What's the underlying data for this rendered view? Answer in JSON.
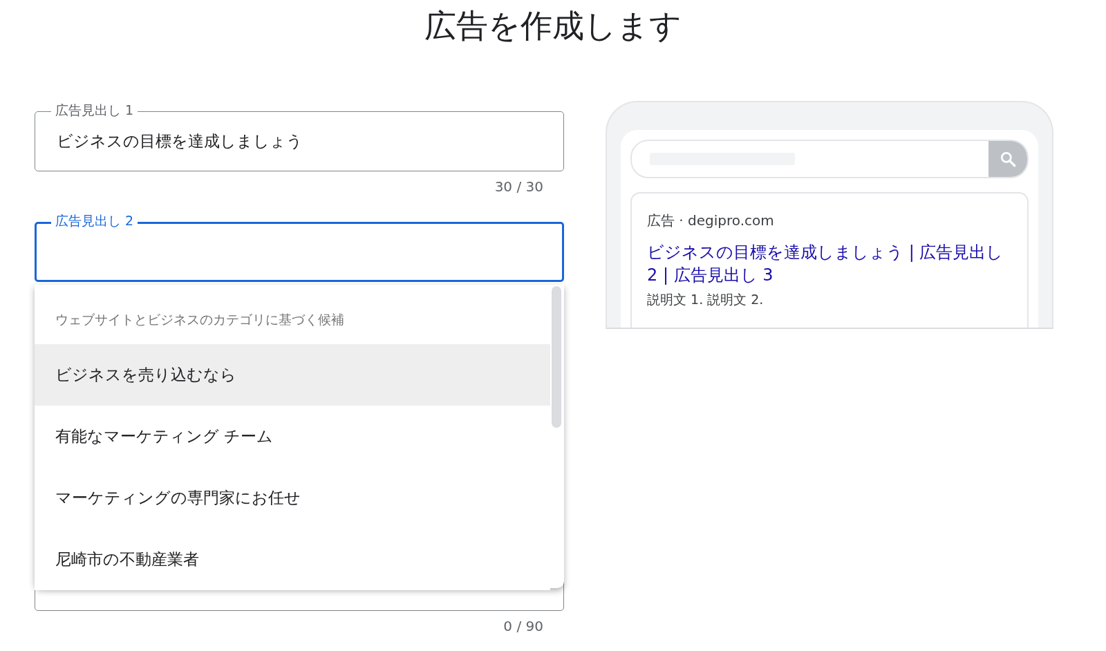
{
  "title": "広告を作成します",
  "fields": [
    {
      "label": "広告見出し 1",
      "value": "ビジネスの目標を達成しましょう",
      "focused": false,
      "counter": "30 / 30"
    },
    {
      "label": "広告見出し 2",
      "focused": true
    }
  ],
  "suggestions": {
    "header": "ウェブサイトとビジネスのカテゴリに基づく候補",
    "items": [
      {
        "label": "ビジネスを売り込むなら",
        "selected": true
      },
      {
        "label": "有能なマーケティング チーム",
        "selected": false
      },
      {
        "label": "マーケティングの専門家にお任せ",
        "selected": false
      },
      {
        "label": "尼崎市の不動産業者",
        "selected": false
      }
    ]
  },
  "hidden_field": {
    "counter": "0 / 90"
  },
  "preview": {
    "ad_label": "広告 · degipro.com",
    "headline": "ビジネスの目標を達成しましょう | 広告見出し 2 | 広告見出し 3",
    "description": "説明文 1. 説明文 2."
  }
}
